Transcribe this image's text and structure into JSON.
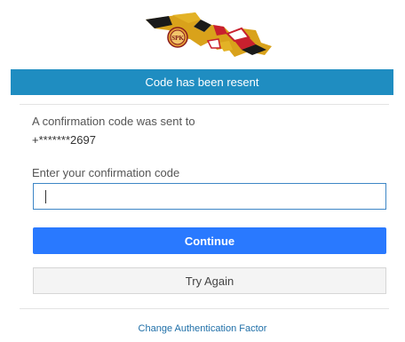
{
  "logo": {
    "icon": "maryland-flag-map-logo",
    "seal_text": "SPK"
  },
  "banner": {
    "text": "Code has been resent",
    "color": "#1f8dc1"
  },
  "info": {
    "line1": "A confirmation code was sent to",
    "phone": "+*******2697"
  },
  "code_field": {
    "label": "Enter your confirmation code",
    "value": ""
  },
  "buttons": {
    "continue": "Continue",
    "try_again": "Try Again"
  },
  "links": {
    "change_factor": "Change Authentication Factor"
  },
  "colors": {
    "accent": "#2979ff",
    "banner": "#1f8dc1",
    "link": "#1f6fa8"
  }
}
